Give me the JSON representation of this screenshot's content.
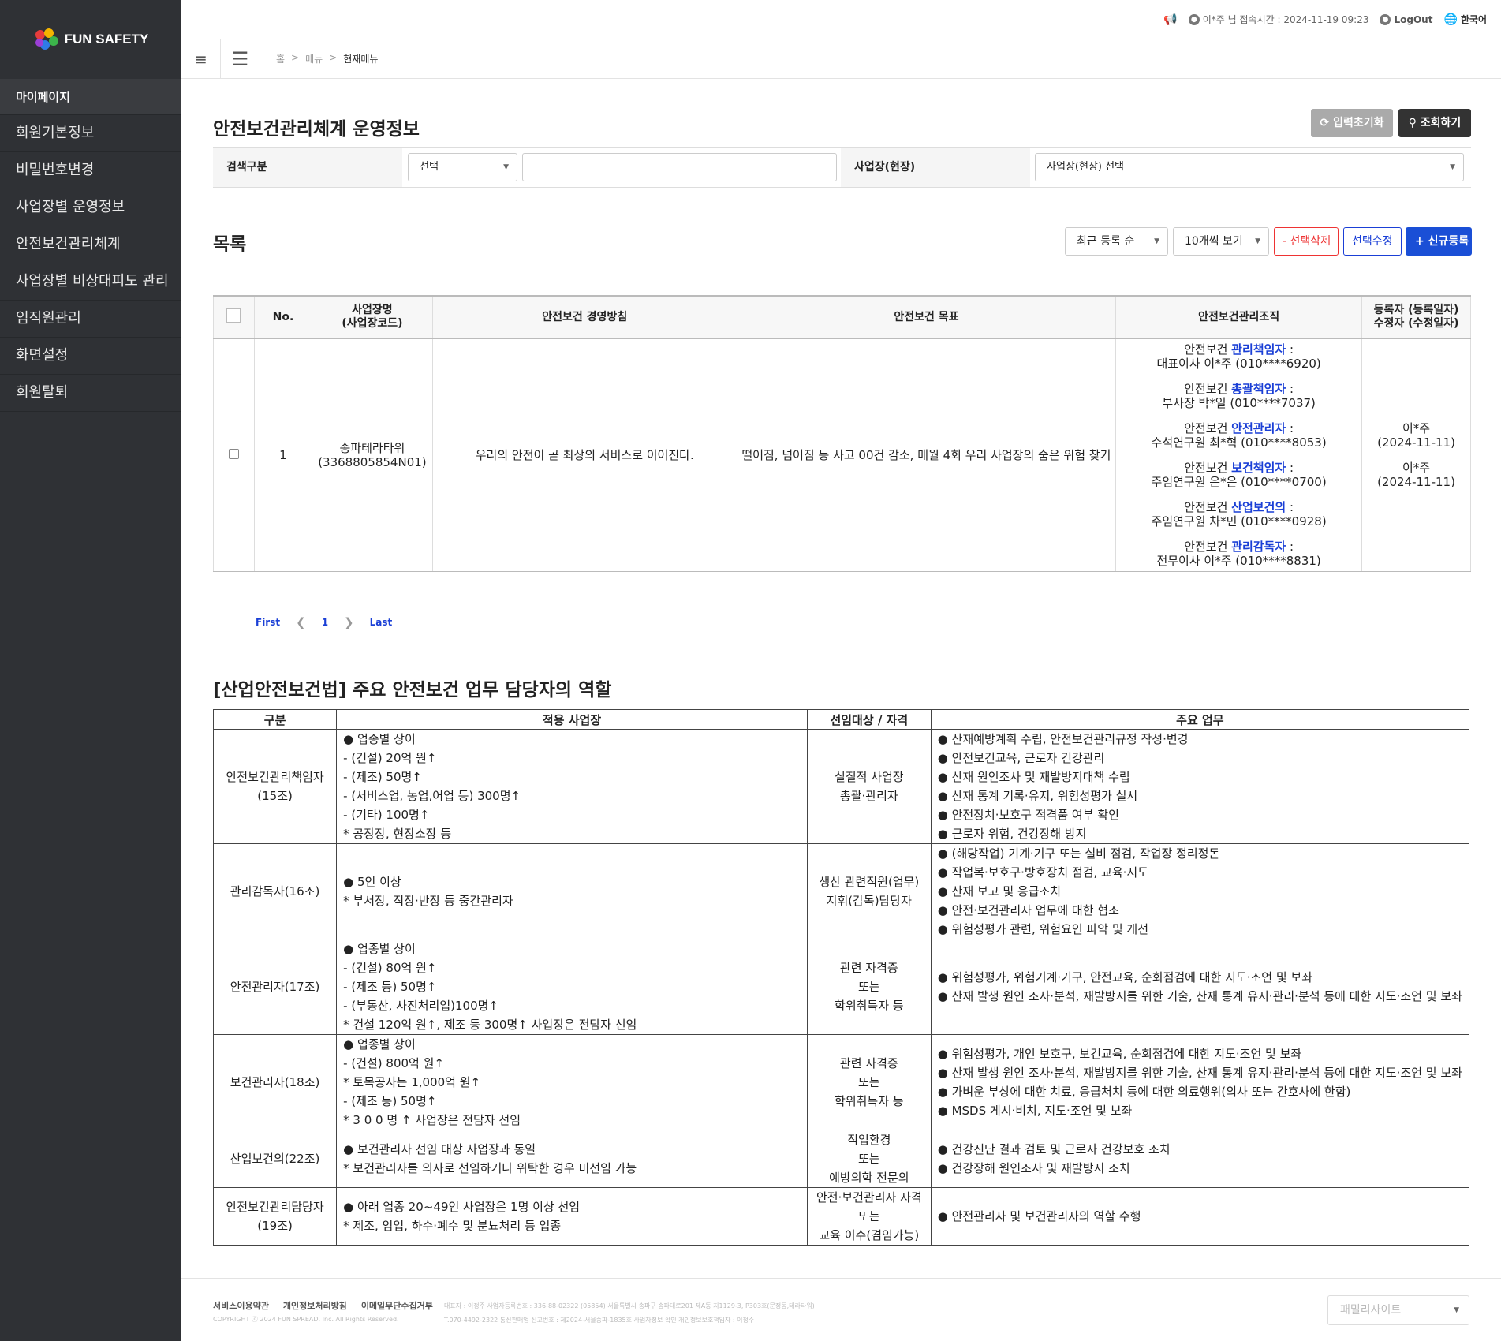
{
  "brand": {
    "name": "FUN SAFETY"
  },
  "sidebar": {
    "header": "마이페이지",
    "items": [
      "회원기본정보",
      "비밀번호변경",
      "사업장별 운영정보",
      "안전보건관리체계",
      "사업장별 비상대피도 관리",
      "임직원관리",
      "화면설정",
      "회원탈퇴"
    ]
  },
  "topbar": {
    "login_info": "이*주 님 접속시간 : 2024-11-19 09:23",
    "logout": "LogOut",
    "language": "한국어"
  },
  "breadcrumb": [
    "홈",
    ">",
    "메뉴",
    ">",
    "현재메뉴"
  ],
  "page": {
    "title": "안전보건관리체계 운영정보",
    "reset_button": "입력초기화",
    "search_button": "조회하기"
  },
  "search": {
    "label": "검색구분",
    "select_value": "선택",
    "text_value": "",
    "site_label": "사업장(현장)",
    "site_select": "사업장(현장) 선택"
  },
  "list": {
    "title": "목록",
    "sort": "최근 등록 순",
    "per_page": "10개씩 보기",
    "delete": "- 선택삭제",
    "edit": "선택수정",
    "new": "+ 신규등록"
  },
  "table": {
    "headers": {
      "no": "No.",
      "site_line1": "사업장명",
      "site_line2": "(사업장코드)",
      "policy": "안전보건 경영방침",
      "goal": "안전보건 목표",
      "org": "안전보건관리조직",
      "reg_line1": "등록자 (등록일자)",
      "reg_line2": "수정자 (수정일자)"
    },
    "rows": [
      {
        "no": "1",
        "site_name": "송파테라타워",
        "site_code": "(3368805854N01)",
        "policy": "우리의 안전이 곧 최상의 서비스로 이어진다.",
        "goal": "떨어짐, 넘어짐 등 사고 00건 감소, 매월 4회 우리 사업장의 숨은 위험 찾기",
        "org": [
          {
            "prefix": "안전보건 ",
            "role": "관리책임자",
            "suffix": " :",
            "person": "대표이사 이*주 (010****6920)"
          },
          {
            "prefix": "안전보건 ",
            "role": "총괄책임자",
            "suffix": " :",
            "person": "부사장 박*일 (010****7037)"
          },
          {
            "prefix": "안전보건 ",
            "role": "안전관리자",
            "suffix": " :",
            "person": "수석연구원 최*혁 (010****8053)"
          },
          {
            "prefix": "안전보건 ",
            "role": "보건책임자",
            "suffix": " :",
            "person": "주임연구원 은*은 (010****0700)"
          },
          {
            "prefix": "안전보건 ",
            "role": "산업보건의",
            "suffix": " :",
            "person": "주임연구원 차*민 (010****0928)"
          },
          {
            "prefix": "안전보건 ",
            "role": "관리감독자",
            "suffix": " :",
            "person": "전무이사 이*주 (010****8831)"
          }
        ],
        "registrant": "이*주",
        "reg_date": "(2024-11-11)",
        "modifier": "이*주",
        "mod_date": "(2024-11-11)"
      }
    ]
  },
  "pagination": {
    "first": "First",
    "page": "1",
    "last": "Last"
  },
  "law": {
    "title": "[산업안전보건법] 주요 안전보건 업무 담당자의 역할",
    "headers": [
      "구분",
      "적용 사업장",
      "선임대상 / 자격",
      "주요 업무"
    ],
    "rows": [
      {
        "role": [
          "안전보건관리책임자",
          "(15조)"
        ],
        "scope": [
          "● 업종별 상이",
          "- (건설) 20억 원↑",
          "- (제조) 50명↑",
          "- (서비스업, 농업,어업 등) 300명↑",
          "- (기타) 100명↑",
          "* 공장장, 현장소장 등"
        ],
        "target": [
          "실질적 사업장",
          "총괄·관리자"
        ],
        "duties": [
          "● 산재예방계획 수립, 안전보건관리규정 작성·변경",
          "● 안전보건교육, 근로자 건강관리",
          "● 산재 원인조사 및 재발방지대책 수립",
          "● 산재 통계 기록·유지, 위험성평가 실시",
          "● 안전장치·보호구 적격품 여부 확인",
          "● 근로자 위험, 건강장해 방지"
        ]
      },
      {
        "role": [
          "관리감독자(16조)"
        ],
        "scope": [
          "● 5인 이상",
          "* 부서장, 직장·반장 등 중간관리자"
        ],
        "target": [
          "생산 관련직원(업무)",
          "지휘(감독)담당자"
        ],
        "duties": [
          "● (해당작업) 기계·기구 또는 설비 점검, 작업장 정리정돈",
          "● 작업복·보호구·방호장치 점검, 교육·지도",
          "● 산재 보고 및 응급조치",
          "● 안전·보건관리자 업무에 대한 협조",
          "● 위험성평가 관련, 위험요인 파악 및 개선"
        ]
      },
      {
        "role": [
          "안전관리자(17조)"
        ],
        "scope": [
          "● 업종별 상이",
          "- (건설) 80억 원↑",
          "- (제조 등) 50명↑",
          "- (부동산, 사진처리업)100명↑",
          "* 건설 120억 원↑, 제조 등 300명↑ 사업장은 전담자 선임"
        ],
        "target": [
          "관련 자격증",
          "또는",
          "학위취득자 등"
        ],
        "duties": [
          "● 위험성평가, 위험기계·기구, 안전교육, 순회점검에 대한 지도·조언 및 보좌",
          "● 산재 발생 원인 조사·분석, 재발방지를 위한 기술, 산재 통계 유지·관리·분석 등에 대한 지도·조언 및 보좌"
        ]
      },
      {
        "role": [
          "보건관리자(18조)"
        ],
        "scope": [
          "● 업종별 상이",
          "- (건설) 800억 원↑",
          "* 토목공사는 1,000억 원↑",
          "- (제조 등) 50명↑",
          "* 3 0 0 명 ↑ 사업장은 전담자 선임"
        ],
        "target": [
          "관련 자격증",
          "또는",
          "학위취득자 등"
        ],
        "duties": [
          "● 위험성평가, 개인 보호구, 보건교육, 순회점검에 대한 지도·조언 및 보좌",
          "● 산재 발생 원인 조사·분석, 재발방지를 위한 기술, 산재 통계 유지·관리·분석 등에 대한 지도·조언 및 보좌",
          "● 가벼운 부상에 대한 치료, 응급처치 등에 대한 의료행위(의사 또는 간호사에 한함)",
          "● MSDS 게시·비치, 지도·조언 및 보좌"
        ]
      },
      {
        "role": [
          "산업보건의(22조)"
        ],
        "scope": [
          "● 보건관리자 선임 대상 사업장과 동일",
          "* 보건관리자를 의사로 선임하거나 위탁한 경우 미선임 가능"
        ],
        "target": [
          "직업환경",
          "또는",
          "예방의학 전문의"
        ],
        "duties": [
          "● 건강진단 결과 검토 및 근로자 건강보호 조치",
          "● 건강장해 원인조사 및 재발방지 조치"
        ]
      },
      {
        "role": [
          "안전보건관리담당자",
          "(19조)"
        ],
        "scope": [
          "● 아래 업종 20~49인 사업장은 1명 이상 선임",
          "* 제조, 임업, 하수·폐수 및 분뇨처리 등 업종"
        ],
        "target": [
          "안전·보건관리자 자격",
          "또는",
          "교육 이수(겸임가능)"
        ],
        "duties": [
          "● 안전관리자 및 보건관리자의 역할 수행"
        ]
      }
    ]
  },
  "footer": {
    "links": [
      "서비스이용약관",
      "개인정보처리방침",
      "이메일무단수집거부"
    ],
    "copyright": "COPYRIGHT ⓒ 2024 FUN SPREAD, Inc. All Rights Reserved.",
    "info1": "대표자 : 이정주 사업자등록번호 : 336-88-02322 (05854) 서울특별시 송파구 송파대로201 제A동 지1129-3, P303호(문정동,테라타워)",
    "info2": "T.070-4492-2322 통신판매업 신고번호 : 제2024-서울송파-1835호 사업자정보 확인 개인정보보호책임자 : 이정주",
    "family": "패밀리사이트"
  }
}
